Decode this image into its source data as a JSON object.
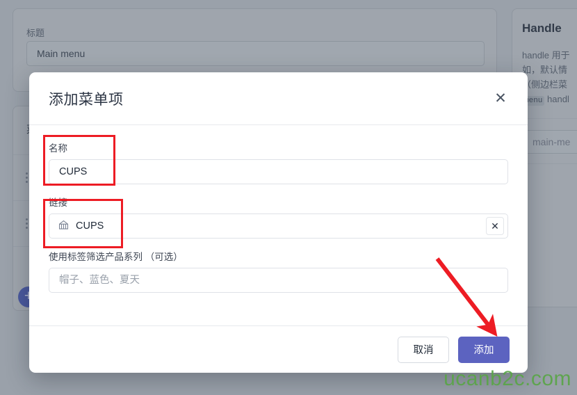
{
  "background": {
    "title_field": {
      "label": "标题",
      "value": "Main menu"
    },
    "items_card": {
      "heading": "菜单项",
      "rows": [
        {
          "grip": "drag-handle"
        },
        {
          "grip": "drag-handle"
        }
      ],
      "add_button_glyph": "+"
    },
    "right_panel": {
      "heading": "Handle",
      "paragraph_lines": [
        "handle 用于",
        "如，默认情",
        "（侧边栏菜",
        "menu handl"
      ],
      "code_chip": "menu",
      "input_value": "main-me"
    }
  },
  "modal": {
    "title": "添加菜单项",
    "close_icon": "close-icon",
    "fields": {
      "name": {
        "label": "名称",
        "value": "CUPS",
        "placeholder": ""
      },
      "link": {
        "label": "链接",
        "value": "CUPS",
        "icon": "storefront-icon",
        "clear_icon": "close-icon"
      },
      "tags": {
        "label": "使用标签筛选产品系列 （可选）",
        "value": "",
        "placeholder": "帽子、蓝色、夏天"
      }
    },
    "buttons": {
      "cancel": "取消",
      "add": "添加"
    }
  },
  "annotations": {
    "highlight_name": "red-rectangle",
    "highlight_link": "red-rectangle",
    "arrow_to_add_button": "red-arrow"
  },
  "watermark": {
    "text": "ucanb2c.com"
  },
  "colors": {
    "accent": "#5c63c0",
    "annotation": "#ed1c24",
    "watermark": "#5aa548",
    "page_bg": "#aab0b8",
    "modal_bg": "#ffffff"
  }
}
